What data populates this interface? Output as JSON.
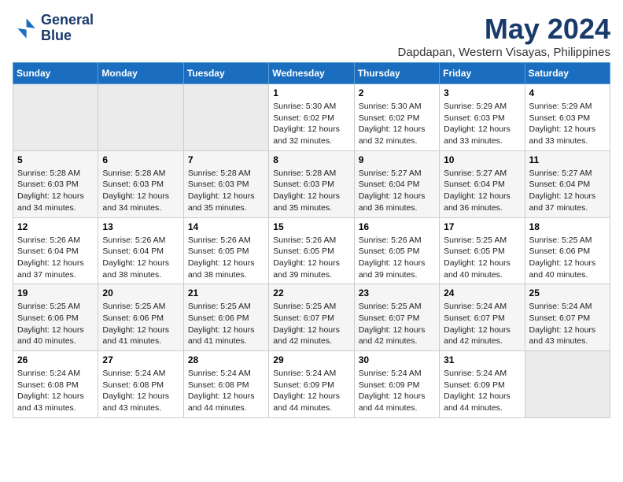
{
  "logo": {
    "line1": "General",
    "line2": "Blue"
  },
  "title": "May 2024",
  "subtitle": "Dapdapan, Western Visayas, Philippines",
  "days_header": [
    "Sunday",
    "Monday",
    "Tuesday",
    "Wednesday",
    "Thursday",
    "Friday",
    "Saturday"
  ],
  "weeks": [
    [
      {
        "day": "",
        "info": "",
        "empty": true
      },
      {
        "day": "",
        "info": "",
        "empty": true
      },
      {
        "day": "",
        "info": "",
        "empty": true
      },
      {
        "day": "1",
        "info": "Sunrise: 5:30 AM\nSunset: 6:02 PM\nDaylight: 12 hours\nand 32 minutes."
      },
      {
        "day": "2",
        "info": "Sunrise: 5:30 AM\nSunset: 6:02 PM\nDaylight: 12 hours\nand 32 minutes."
      },
      {
        "day": "3",
        "info": "Sunrise: 5:29 AM\nSunset: 6:03 PM\nDaylight: 12 hours\nand 33 minutes."
      },
      {
        "day": "4",
        "info": "Sunrise: 5:29 AM\nSunset: 6:03 PM\nDaylight: 12 hours\nand 33 minutes."
      }
    ],
    [
      {
        "day": "5",
        "info": "Sunrise: 5:28 AM\nSunset: 6:03 PM\nDaylight: 12 hours\nand 34 minutes."
      },
      {
        "day": "6",
        "info": "Sunrise: 5:28 AM\nSunset: 6:03 PM\nDaylight: 12 hours\nand 34 minutes."
      },
      {
        "day": "7",
        "info": "Sunrise: 5:28 AM\nSunset: 6:03 PM\nDaylight: 12 hours\nand 35 minutes."
      },
      {
        "day": "8",
        "info": "Sunrise: 5:28 AM\nSunset: 6:03 PM\nDaylight: 12 hours\nand 35 minutes."
      },
      {
        "day": "9",
        "info": "Sunrise: 5:27 AM\nSunset: 6:04 PM\nDaylight: 12 hours\nand 36 minutes."
      },
      {
        "day": "10",
        "info": "Sunrise: 5:27 AM\nSunset: 6:04 PM\nDaylight: 12 hours\nand 36 minutes."
      },
      {
        "day": "11",
        "info": "Sunrise: 5:27 AM\nSunset: 6:04 PM\nDaylight: 12 hours\nand 37 minutes."
      }
    ],
    [
      {
        "day": "12",
        "info": "Sunrise: 5:26 AM\nSunset: 6:04 PM\nDaylight: 12 hours\nand 37 minutes."
      },
      {
        "day": "13",
        "info": "Sunrise: 5:26 AM\nSunset: 6:04 PM\nDaylight: 12 hours\nand 38 minutes."
      },
      {
        "day": "14",
        "info": "Sunrise: 5:26 AM\nSunset: 6:05 PM\nDaylight: 12 hours\nand 38 minutes."
      },
      {
        "day": "15",
        "info": "Sunrise: 5:26 AM\nSunset: 6:05 PM\nDaylight: 12 hours\nand 39 minutes."
      },
      {
        "day": "16",
        "info": "Sunrise: 5:26 AM\nSunset: 6:05 PM\nDaylight: 12 hours\nand 39 minutes."
      },
      {
        "day": "17",
        "info": "Sunrise: 5:25 AM\nSunset: 6:05 PM\nDaylight: 12 hours\nand 40 minutes."
      },
      {
        "day": "18",
        "info": "Sunrise: 5:25 AM\nSunset: 6:06 PM\nDaylight: 12 hours\nand 40 minutes."
      }
    ],
    [
      {
        "day": "19",
        "info": "Sunrise: 5:25 AM\nSunset: 6:06 PM\nDaylight: 12 hours\nand 40 minutes."
      },
      {
        "day": "20",
        "info": "Sunrise: 5:25 AM\nSunset: 6:06 PM\nDaylight: 12 hours\nand 41 minutes."
      },
      {
        "day": "21",
        "info": "Sunrise: 5:25 AM\nSunset: 6:06 PM\nDaylight: 12 hours\nand 41 minutes."
      },
      {
        "day": "22",
        "info": "Sunrise: 5:25 AM\nSunset: 6:07 PM\nDaylight: 12 hours\nand 42 minutes."
      },
      {
        "day": "23",
        "info": "Sunrise: 5:25 AM\nSunset: 6:07 PM\nDaylight: 12 hours\nand 42 minutes."
      },
      {
        "day": "24",
        "info": "Sunrise: 5:24 AM\nSunset: 6:07 PM\nDaylight: 12 hours\nand 42 minutes."
      },
      {
        "day": "25",
        "info": "Sunrise: 5:24 AM\nSunset: 6:07 PM\nDaylight: 12 hours\nand 43 minutes."
      }
    ],
    [
      {
        "day": "26",
        "info": "Sunrise: 5:24 AM\nSunset: 6:08 PM\nDaylight: 12 hours\nand 43 minutes."
      },
      {
        "day": "27",
        "info": "Sunrise: 5:24 AM\nSunset: 6:08 PM\nDaylight: 12 hours\nand 43 minutes."
      },
      {
        "day": "28",
        "info": "Sunrise: 5:24 AM\nSunset: 6:08 PM\nDaylight: 12 hours\nand 44 minutes."
      },
      {
        "day": "29",
        "info": "Sunrise: 5:24 AM\nSunset: 6:09 PM\nDaylight: 12 hours\nand 44 minutes."
      },
      {
        "day": "30",
        "info": "Sunrise: 5:24 AM\nSunset: 6:09 PM\nDaylight: 12 hours\nand 44 minutes."
      },
      {
        "day": "31",
        "info": "Sunrise: 5:24 AM\nSunset: 6:09 PM\nDaylight: 12 hours\nand 44 minutes."
      },
      {
        "day": "",
        "info": "",
        "empty": true
      }
    ]
  ]
}
